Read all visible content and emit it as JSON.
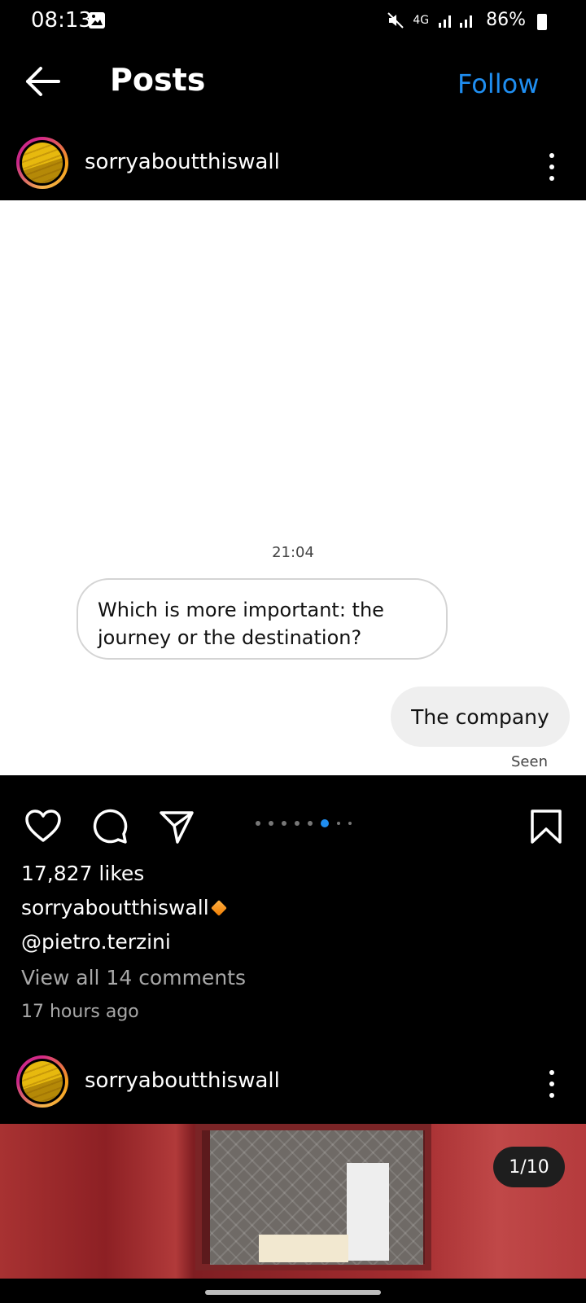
{
  "status_bar": {
    "time": "08:13",
    "network": "4G",
    "battery": "86%"
  },
  "header": {
    "title": "Posts",
    "follow_label": "Follow"
  },
  "post1": {
    "username": "sorryaboutthiswall",
    "chat": {
      "time": "21:04",
      "incoming_message": "Which is more important: the journey or the destination?",
      "outgoing_message": "The company",
      "status": "Seen"
    },
    "carousel": {
      "total": 8,
      "active_index": 5
    },
    "likes": "17,827 likes",
    "caption_user": "sorryaboutthiswall",
    "caption_mention": "@pietro.terzini",
    "view_comments": "View all 14 comments",
    "posted_ago": "17 hours ago"
  },
  "post2": {
    "username": "sorryaboutthiswall",
    "image_counter": "1/10"
  },
  "colors": {
    "accent": "#1f8ef1",
    "background": "#000000",
    "secondary_text": "#a8a8a8"
  },
  "icons": [
    "back-arrow-icon",
    "more-icon",
    "heart-icon",
    "comment-icon",
    "share-icon",
    "bookmark-icon",
    "image-icon",
    "mute-icon",
    "signal-icon",
    "battery-icon"
  ]
}
